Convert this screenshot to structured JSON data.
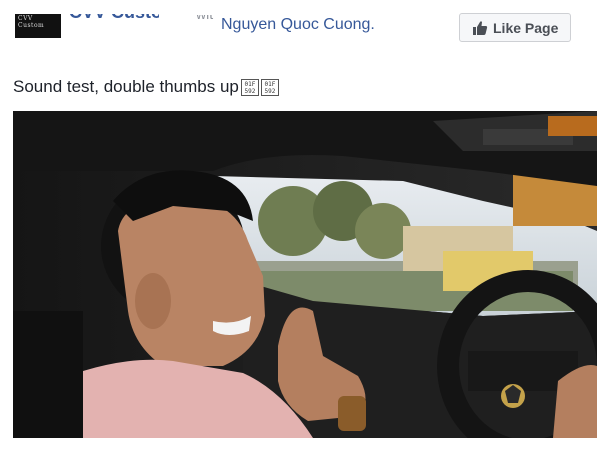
{
  "post": {
    "header": {
      "page_avatar": "CVV Custom",
      "page_name": "CVV Custom",
      "with_text": "with",
      "tagged_person": "Nguyen Quoc Cuong.",
      "like_button": {
        "label": "Like Page",
        "icon": "thumbs-up-icon"
      }
    },
    "text": "Sound test, double thumbs up",
    "emoji_glyphs": [
      {
        "line1": "01F",
        "line2": "592"
      },
      {
        "line1": "01F",
        "line2": "592"
      }
    ],
    "video": {
      "icon": "steering-wheel-badge"
    }
  },
  "colors": {
    "link": "#365899",
    "text": "#1d2129",
    "button_bg": "#f6f7f9",
    "button_border": "#ced0d4",
    "button_text": "#4b4f56"
  }
}
